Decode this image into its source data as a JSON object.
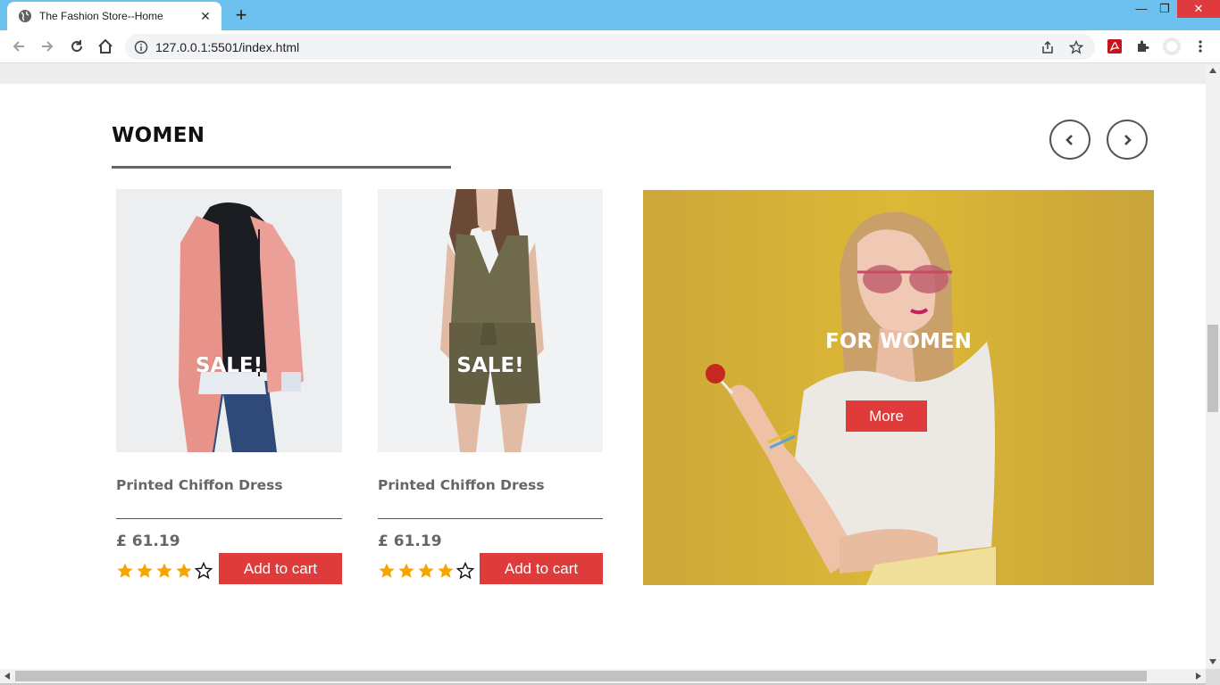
{
  "browser": {
    "tab_title": "The Fashion Store--Home",
    "url": "127.0.0.1:5501/index.html"
  },
  "section": {
    "title": "WOMEN"
  },
  "products": [
    {
      "badge": "SALE!",
      "name": "Printed Chiffon Dress",
      "price": "£ 61.19",
      "rating": 4,
      "max_rating": 5,
      "add_label": "Add to cart"
    },
    {
      "badge": "SALE!",
      "name": "Printed Chiffon Dress",
      "price": "£ 61.19",
      "rating": 4,
      "max_rating": 5,
      "add_label": "Add to cart"
    }
  ],
  "banner": {
    "title": "FOR WOMEN",
    "button_label": "More"
  },
  "colors": {
    "accent_red": "#df3b3b",
    "star_gold": "#f5a400",
    "titlebar_blue": "#6cc1ef",
    "banner_yellow": "#d5b133"
  },
  "icons": {
    "back": "arrow-left-icon",
    "forward": "arrow-right-icon",
    "reload": "reload-icon",
    "home": "home-icon",
    "info": "info-icon",
    "share": "share-icon",
    "bookmark": "star-icon",
    "pdf": "pdf-extension-icon",
    "extensions": "puzzle-icon",
    "profile": "profile-icon",
    "menu": "kebab-menu-icon",
    "prev": "chevron-left-icon",
    "next": "chevron-right-icon"
  }
}
